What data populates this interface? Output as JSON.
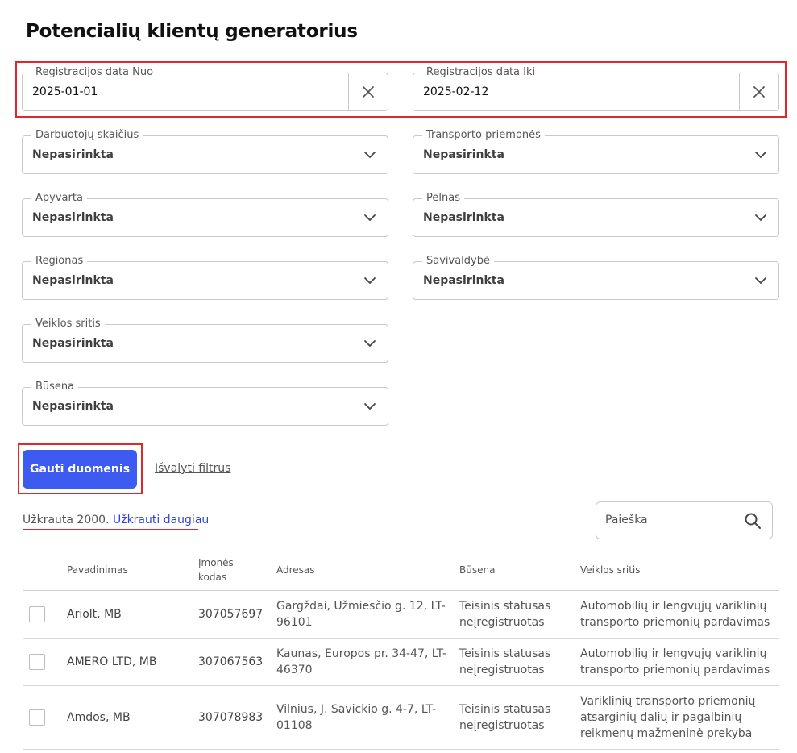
{
  "page": {
    "title": "Potencialių klientų generatorius"
  },
  "filters": {
    "date_from": {
      "label": "Registracijos data Nuo",
      "value": "2025-01-01"
    },
    "date_to": {
      "label": "Registracijos data Iki",
      "value": "2025-02-12"
    },
    "employees": {
      "label": "Darbuotojų skaičius",
      "value": "Nepasirinkta"
    },
    "vehicles": {
      "label": "Transporto priemonės",
      "value": "Nepasirinkta"
    },
    "turnover": {
      "label": "Apyvarta",
      "value": "Nepasirinkta"
    },
    "profit": {
      "label": "Pelnas",
      "value": "Nepasirinkta"
    },
    "region": {
      "label": "Regionas",
      "value": "Nepasirinkta"
    },
    "municipality": {
      "label": "Savivaldybė",
      "value": "Nepasirinkta"
    },
    "activity": {
      "label": "Veiklos sritis",
      "value": "Nepasirinkta"
    },
    "status": {
      "label": "Būsena",
      "value": "Nepasirinkta"
    }
  },
  "actions": {
    "get_data_label": "Gauti duomenis",
    "clear_filters_label": "Išvalyti filtrus"
  },
  "results": {
    "loaded_text": "Užkrauta 2000.",
    "load_more_label": "Užkrauti daugiau",
    "search_placeholder": "Paieška"
  },
  "table": {
    "columns": [
      "Pavadinimas",
      "Įmonės kodas",
      "Adresas",
      "Būsena",
      "Veiklos sritis"
    ],
    "rows": [
      {
        "name": "Ariolt, MB",
        "code": "307057697",
        "address": "Gargždai, Užmiesčio g. 12, LT-96101",
        "status": "Teisinis statusas neįregistruotas",
        "activity": "Automobilių ir lengvųjų variklinių transporto priemonių pardavimas"
      },
      {
        "name": "AMERO LTD, MB",
        "code": "307067563",
        "address": "Kaunas, Europos pr. 34-47, LT-46370",
        "status": "Teisinis statusas neįregistruotas",
        "activity": "Automobilių ir lengvųjų variklinių transporto priemonių pardavimas"
      },
      {
        "name": "Amdos, MB",
        "code": "307078983",
        "address": "Vilnius, J. Savickio g. 4-7, LT-01108",
        "status": "Teisinis statusas neįregistruotas",
        "activity": "Variklinių transporto priemonių atsarginių dalių ir pagalbinių reikmenų mažmeninė prekyba"
      }
    ]
  },
  "colors": {
    "primary": "#3d5af1",
    "highlight": "#e0282b",
    "link": "#2c45d6"
  }
}
